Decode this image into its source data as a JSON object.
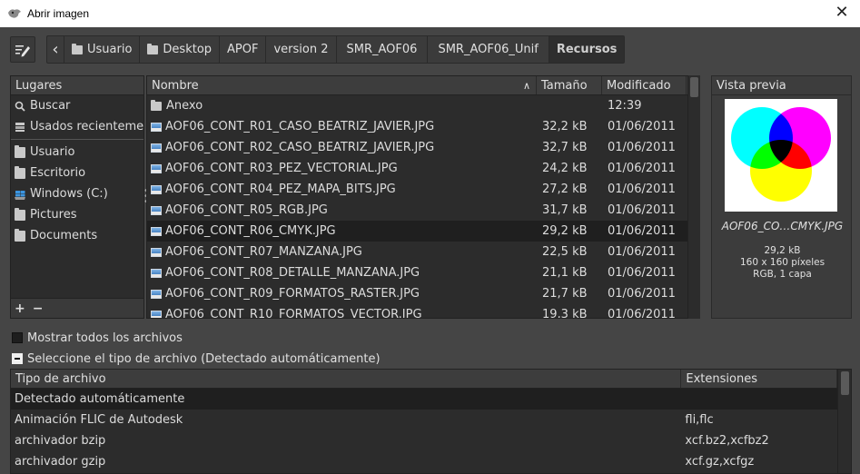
{
  "window": {
    "title": "Abrir imagen",
    "close_glyph": "✕"
  },
  "pathbar": {
    "back_glyph": "‹",
    "crumbs": [
      "Usuario",
      "Desktop",
      "APOF",
      "version 2",
      "SMR_AOF06",
      "SMR_AOF06_Unif",
      "Recursos"
    ]
  },
  "places": {
    "header": "Lugares",
    "items": [
      {
        "label": "Buscar",
        "icon": "search-icon"
      },
      {
        "label": "Usados recientemente",
        "icon": "recent-icon"
      },
      {
        "label": "Usuario",
        "icon": "folder-icon"
      },
      {
        "label": "Escritorio",
        "icon": "folder-icon"
      },
      {
        "label": "Windows (C:)",
        "icon": "drive-icon"
      },
      {
        "label": "Pictures",
        "icon": "folder-icon"
      },
      {
        "label": "Documents",
        "icon": "folder-icon"
      }
    ],
    "add_glyph": "+",
    "remove_glyph": "−"
  },
  "files": {
    "headers": {
      "name": "Nombre",
      "size": "Tamaño",
      "modified": "Modificado"
    },
    "rows": [
      {
        "name": "Anexo",
        "size": "",
        "modified": "12:39",
        "type": "folder"
      },
      {
        "name": "AOF06_CONT_R01_CASO_BEATRIZ_JAVIER.JPG",
        "size": "32,2 kB",
        "modified": "01/06/2011",
        "type": "image"
      },
      {
        "name": "AOF06_CONT_R02_CASO_BEATRIZ_JAVIER.JPG",
        "size": "32,7 kB",
        "modified": "01/06/2011",
        "type": "image"
      },
      {
        "name": "AOF06_CONT_R03_PEZ_VECTORIAL.JPG",
        "size": "24,2 kB",
        "modified": "01/06/2011",
        "type": "image"
      },
      {
        "name": "AOF06_CONT_R04_PEZ_MAPA_BITS.JPG",
        "size": "27,2 kB",
        "modified": "01/06/2011",
        "type": "image"
      },
      {
        "name": "AOF06_CONT_R05_RGB.JPG",
        "size": "31,7 kB",
        "modified": "01/06/2011",
        "type": "image"
      },
      {
        "name": "AOF06_CONT_R06_CMYK.JPG",
        "size": "29,2 kB",
        "modified": "01/06/2011",
        "type": "image",
        "selected": true
      },
      {
        "name": "AOF06_CONT_R07_MANZANA.JPG",
        "size": "22,5 kB",
        "modified": "01/06/2011",
        "type": "image"
      },
      {
        "name": "AOF06_CONT_R08_DETALLE_MANZANA.JPG",
        "size": "21,1 kB",
        "modified": "01/06/2011",
        "type": "image"
      },
      {
        "name": "AOF06_CONT_R09_FORMATOS_RASTER.JPG",
        "size": "21,7 kB",
        "modified": "01/06/2011",
        "type": "image"
      },
      {
        "name": "AOF06_CONT_R10_FORMATOS_VECTOR.JPG",
        "size": "19,3 kB",
        "modified": "01/06/2011",
        "type": "image"
      }
    ]
  },
  "preview": {
    "header": "Vista previa",
    "name": "AOF06_CO…CMYK.JPG",
    "size": "29,2 kB",
    "dimensions": "160 x 160 píxeles",
    "mode": "RGB, 1 capa"
  },
  "options": {
    "show_all": "Mostrar todos los archivos",
    "select_type": "Seleccione el tipo de archivo (Detectado automáticamente)"
  },
  "types": {
    "headers": {
      "name": "Tipo de archivo",
      "ext": "Extensiones"
    },
    "rows": [
      {
        "name": "Detectado automáticamente",
        "ext": "",
        "selected": true
      },
      {
        "name": "Animación FLIC de Autodesk",
        "ext": "fli,flc"
      },
      {
        "name": "archivador bzip",
        "ext": "xcf.bz2,xcfbz2"
      },
      {
        "name": "archivador gzip",
        "ext": "xcf.gz,xcfgz"
      }
    ]
  }
}
